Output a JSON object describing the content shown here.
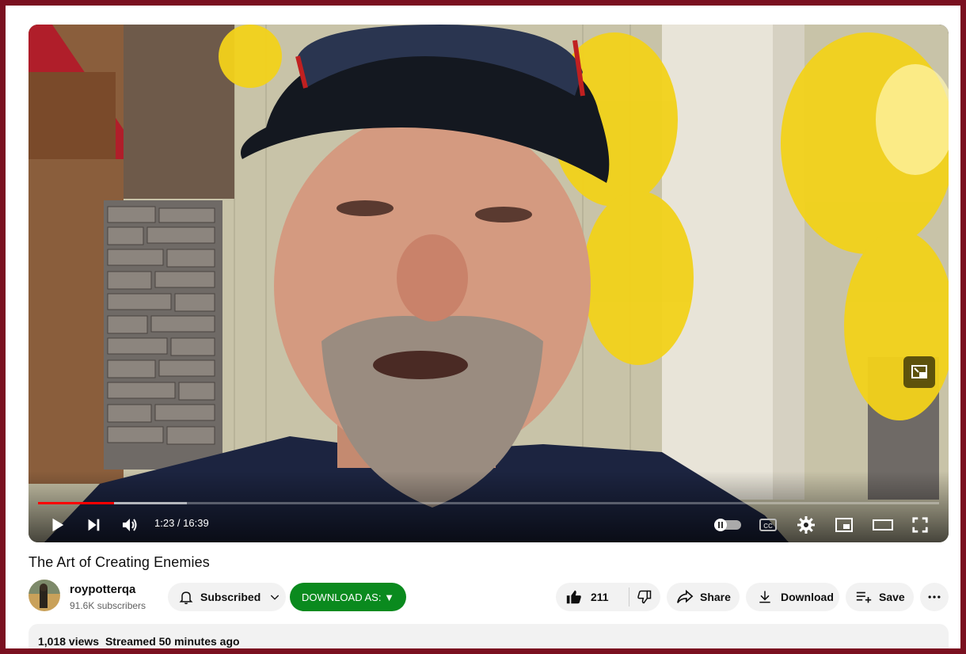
{
  "player": {
    "current_time": "1:23",
    "time_separator": " / ",
    "duration": "16:39",
    "progress_fraction": 0.084,
    "buffered_fraction": 0.165
  },
  "video": {
    "title": "The Art of Creating Enemies"
  },
  "channel": {
    "name": "roypotterqa",
    "subscribers": "91.6K subscribers",
    "subscribed_label": "Subscribed"
  },
  "actions": {
    "download_as_label": "DOWNLOAD AS: ▼",
    "like_count": "211",
    "share_label": "Share",
    "download_label": "Download",
    "save_label": "Save"
  },
  "description": {
    "views": "1,018 views",
    "streamed": "Streamed 50 minutes ago"
  },
  "colors": {
    "frame": "#7a1020",
    "progress": "#ff0000",
    "download_as": "#0a8a1e"
  },
  "icons": [
    "play-icon",
    "next-icon",
    "volume-icon",
    "autoplay-toggle-icon",
    "captions-icon",
    "settings-icon",
    "miniplayer-icon",
    "theater-icon",
    "fullscreen-icon",
    "bell-icon",
    "chevron-down-icon",
    "like-icon",
    "dislike-icon",
    "share-icon",
    "download-icon",
    "save-icon",
    "more-icon"
  ]
}
